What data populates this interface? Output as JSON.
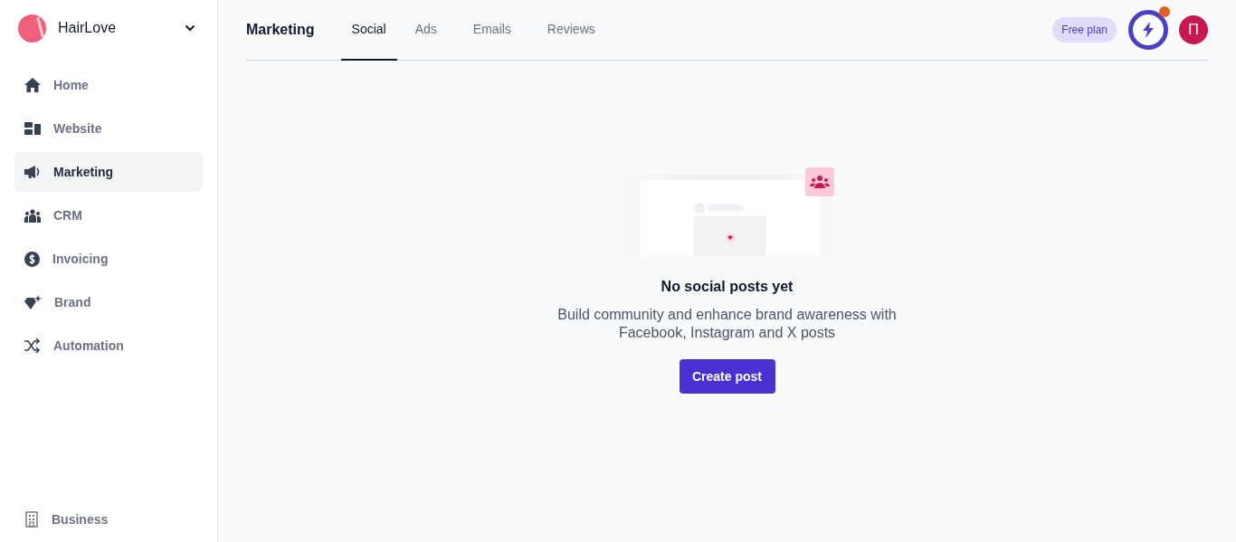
{
  "workspace": {
    "name": "HairLove"
  },
  "sidebar": {
    "items": [
      {
        "label": "Home",
        "selected": false
      },
      {
        "label": "Website",
        "selected": false
      },
      {
        "label": "Marketing",
        "selected": true
      },
      {
        "label": "CRM",
        "selected": false
      },
      {
        "label": "Invoicing",
        "selected": false
      },
      {
        "label": "Brand",
        "selected": false
      },
      {
        "label": "Automation",
        "selected": false
      }
    ],
    "footer_item": {
      "label": "Business"
    }
  },
  "header": {
    "title": "Marketing",
    "tabs": [
      {
        "label": "Social",
        "selected": true
      },
      {
        "label": "Ads",
        "selected": false
      },
      {
        "label": "Emails",
        "selected": false
      },
      {
        "label": "Reviews",
        "selected": false
      }
    ],
    "plan_badge": "Free plan",
    "notification": true,
    "avatar": "П"
  },
  "empty_state": {
    "title": "No social posts yet",
    "description": "Build community and enhance brand awareness with Facebook, Instagram and X posts",
    "button": "Create post"
  }
}
